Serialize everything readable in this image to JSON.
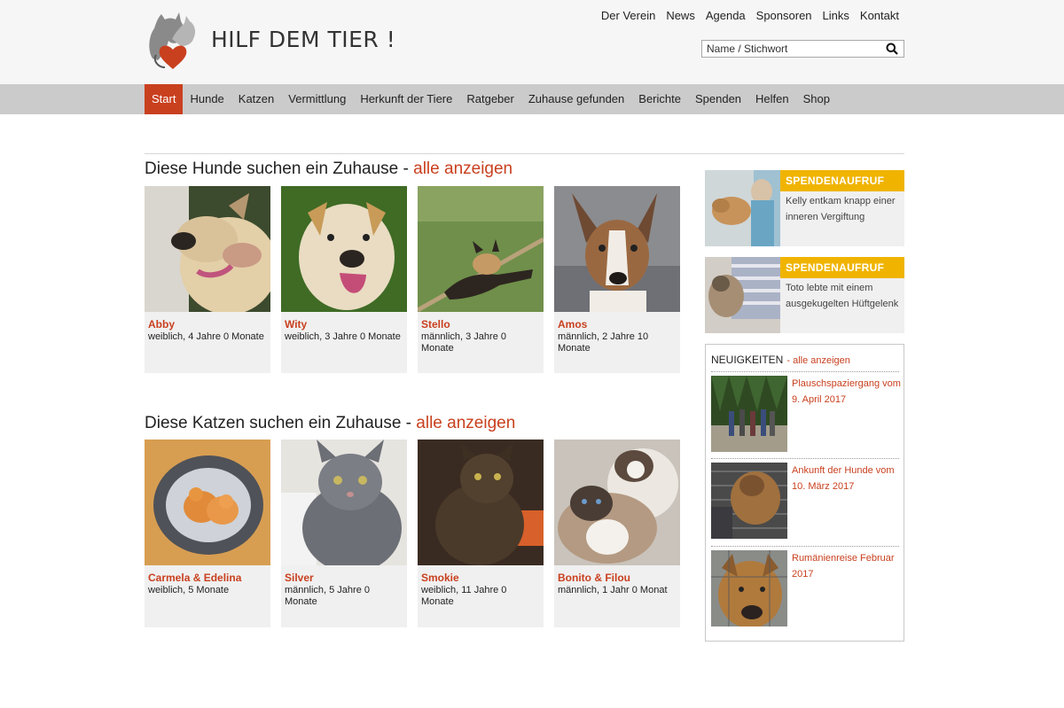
{
  "brand": {
    "name": "HILF DEM TIER !"
  },
  "top_nav": [
    "Der Verein",
    "News",
    "Agenda",
    "Sponsoren",
    "Links",
    "Kontakt"
  ],
  "search": {
    "placeholder": "Name / Stichwort"
  },
  "main_nav": [
    "Start",
    "Hunde",
    "Katzen",
    "Vermittlung",
    "Herkunft der Tiere",
    "Ratgeber",
    "Zuhause gefunden",
    "Berichte",
    "Spenden",
    "Helfen",
    "Shop"
  ],
  "dogs": {
    "title": "Diese Hunde suchen ein Zuhause -",
    "more": "alle anzeigen",
    "items": [
      {
        "name": "Abby",
        "info": "weiblich, 4 Jahre 0 Monate"
      },
      {
        "name": "Wity",
        "info": "weiblich, 3 Jahre 0 Monate"
      },
      {
        "name": "Stello",
        "info": "männlich, 3 Jahre 0 Monate"
      },
      {
        "name": "Amos",
        "info": "männlich, 2 Jahre 10 Monate"
      }
    ]
  },
  "cats": {
    "title": "Diese Katzen suchen ein Zuhause -",
    "more": "alle anzeigen",
    "items": [
      {
        "name": "Carmela & Edelina",
        "info": "weiblich, 5 Monate"
      },
      {
        "name": "Silver",
        "info": "männlich, 5 Jahre 0 Monate"
      },
      {
        "name": "Smokie",
        "info": "weiblich, 11 Jahre 0 Monate"
      },
      {
        "name": "Bonito & Filou",
        "info": "männlich, 1 Jahr 0 Monat"
      }
    ]
  },
  "promos": [
    {
      "tag": "SPENDENAUFRUF",
      "text": "Kelly entkam knapp einer inneren Vergiftung"
    },
    {
      "tag": "SPENDENAUFRUF",
      "text": "Toto lebte mit einem ausgekugelten Hüftgelenk"
    }
  ],
  "news": {
    "title": "NEUIGKEITEN",
    "more": "- alle anzeigen",
    "items": [
      {
        "text": "Plauschspaziergang vom 9. April 2017"
      },
      {
        "text": "Ankunft der Hunde vom 10. März 2017"
      },
      {
        "text": "Rumänienreise Februar 2017"
      }
    ]
  },
  "colors": {
    "accent": "#c9401f",
    "promo_tag": "#f0b400",
    "nav_bg": "#cbcbcb",
    "card_bg": "#f0f0f0"
  }
}
